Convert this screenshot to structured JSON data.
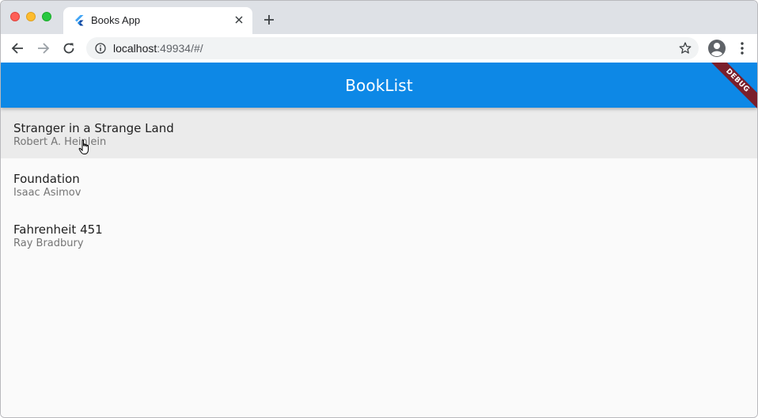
{
  "browser": {
    "tab": {
      "title": "Books App",
      "favicon": "flutter-icon"
    },
    "url": {
      "host": "localhost",
      "rest": ":49934/#/"
    },
    "icons": [
      "back-arrow-icon",
      "forward-arrow-icon",
      "reload-icon",
      "info-icon",
      "star-icon",
      "profile-icon",
      "menu-dots-icon",
      "close-icon",
      "plus-icon"
    ]
  },
  "app": {
    "title": "BookList",
    "debug_label": "DEBUG",
    "colors": {
      "appbar": "#0d88e6",
      "debug_banner": "#7a1f2b",
      "hover": "#ebebeb"
    },
    "books": [
      {
        "title": "Stranger in a Strange Land",
        "author": "Robert A. Heinlein"
      },
      {
        "title": "Foundation",
        "author": "Isaac Asimov"
      },
      {
        "title": "Fahrenheit 451",
        "author": "Ray Bradbury"
      }
    ]
  }
}
